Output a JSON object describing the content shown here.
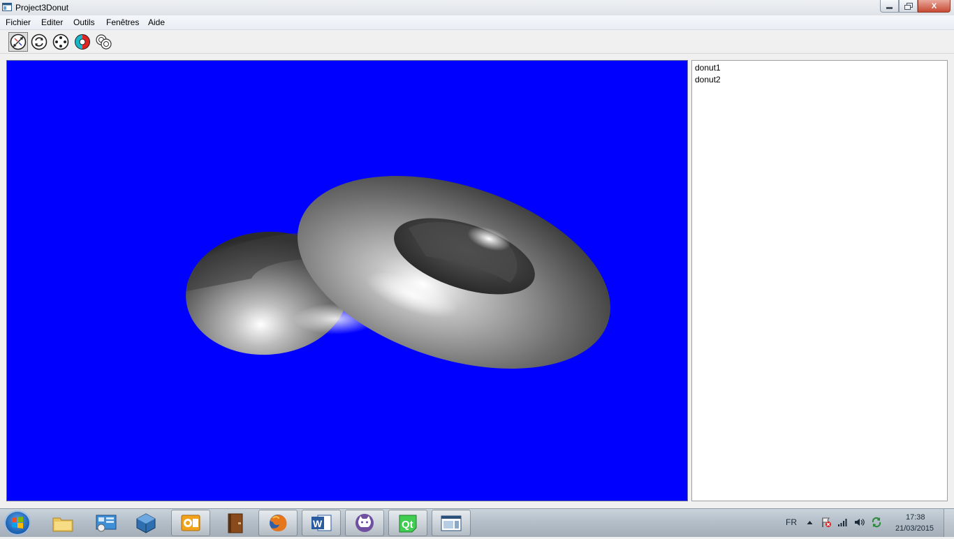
{
  "window": {
    "title": "Project3Donut",
    "min_icon": "minimize-icon",
    "max_icon": "restore-icon",
    "close_label": "X"
  },
  "menu": [
    "Fichier",
    "Editer",
    "Outils",
    "Fenêtres",
    "Aide"
  ],
  "toolbar": {
    "tools": [
      "navigate-icon",
      "rotate-icon",
      "points-icon",
      "color-wheel-icon",
      "rings-icon"
    ],
    "active_index": 0
  },
  "viewport": {
    "background": "#0000ff",
    "objects": [
      "donut1",
      "donut2"
    ]
  },
  "object_list": {
    "items": [
      "donut1",
      "donut2"
    ]
  },
  "taskbar": {
    "apps": [
      "explorer-icon",
      "control-panel-icon",
      "virtualbox-icon",
      "outlook-icon",
      "book-icon",
      "firefox-icon",
      "word-icon",
      "github-icon",
      "qt-creator-icon",
      "window-app-icon"
    ],
    "running": [
      3,
      5,
      6,
      7,
      8,
      9
    ],
    "tray": {
      "language": "FR",
      "time": "17:38",
      "date": "21/03/2015"
    }
  }
}
